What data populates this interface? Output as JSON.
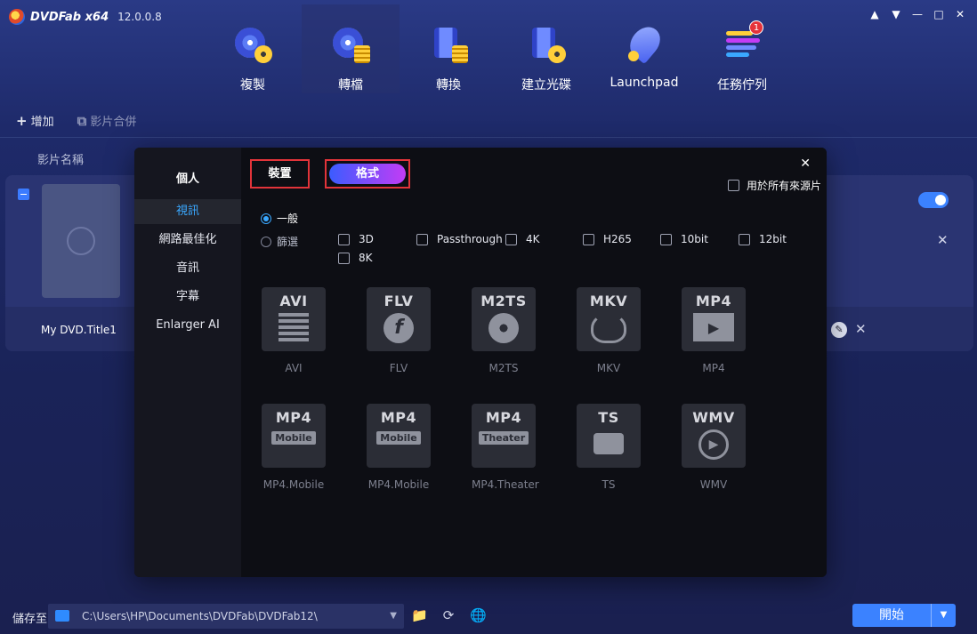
{
  "app": {
    "name": "DVDFab x64",
    "version": "12.0.0.8"
  },
  "nav": [
    {
      "label": "複製",
      "icon": "copy-disc-icon"
    },
    {
      "label": "轉檔",
      "icon": "ripper-icon",
      "active": true
    },
    {
      "label": "轉換",
      "icon": "converter-icon"
    },
    {
      "label": "建立光碟",
      "icon": "creator-icon"
    },
    {
      "label": "Launchpad",
      "icon": "rocket-icon"
    },
    {
      "label": "任務佇列",
      "icon": "task-queue-icon",
      "badge": "1"
    }
  ],
  "toolbar": {
    "add_label": "增加",
    "merge_label": "影片合併"
  },
  "list": {
    "column_header": "影片名稱",
    "title": "My DVD.Title1"
  },
  "modal": {
    "side_header": "個人",
    "side_items": [
      "視訊",
      "網路最佳化",
      "音訊",
      "字幕",
      "Enlarger AI"
    ],
    "tab_device": "裝置",
    "tab_format": "格式",
    "apply_all": "用於所有來源片",
    "radio_general": "一般",
    "radio_filter": "篩選",
    "filters": [
      "3D",
      "Passthrough",
      "4K",
      "H265",
      "10bit",
      "12bit",
      "8K"
    ],
    "formats": [
      {
        "title": "AVI",
        "label": "AVI",
        "art": "film-icon"
      },
      {
        "title": "FLV",
        "label": "FLV",
        "art": "flash-icon"
      },
      {
        "title": "M2TS",
        "label": "M2TS",
        "art": "reel-icon"
      },
      {
        "title": "MKV",
        "label": "MKV",
        "art": "mkv-icon"
      },
      {
        "title": "MP4",
        "label": "MP4",
        "art": "play-icon"
      },
      {
        "title": "MP4",
        "sub": "Mobile",
        "label": "MP4.Mobile"
      },
      {
        "title": "MP4",
        "sub": "Mobile",
        "label": "MP4.Mobile"
      },
      {
        "title": "MP4",
        "sub": "Theater",
        "label": "MP4.Theater"
      },
      {
        "title": "TS",
        "label": "TS",
        "art": "camera-icon"
      },
      {
        "title": "WMV",
        "label": "WMV",
        "art": "play-circle-icon"
      }
    ]
  },
  "bottom": {
    "save_label": "儲存至",
    "path": "C:\\Users\\HP\\Documents\\DVDFab\\DVDFab12\\",
    "start_label": "開始"
  },
  "colors": {
    "accent": "#3b82ff",
    "highlight_border": "#e2343a",
    "active_side": "#3aa8ff"
  }
}
